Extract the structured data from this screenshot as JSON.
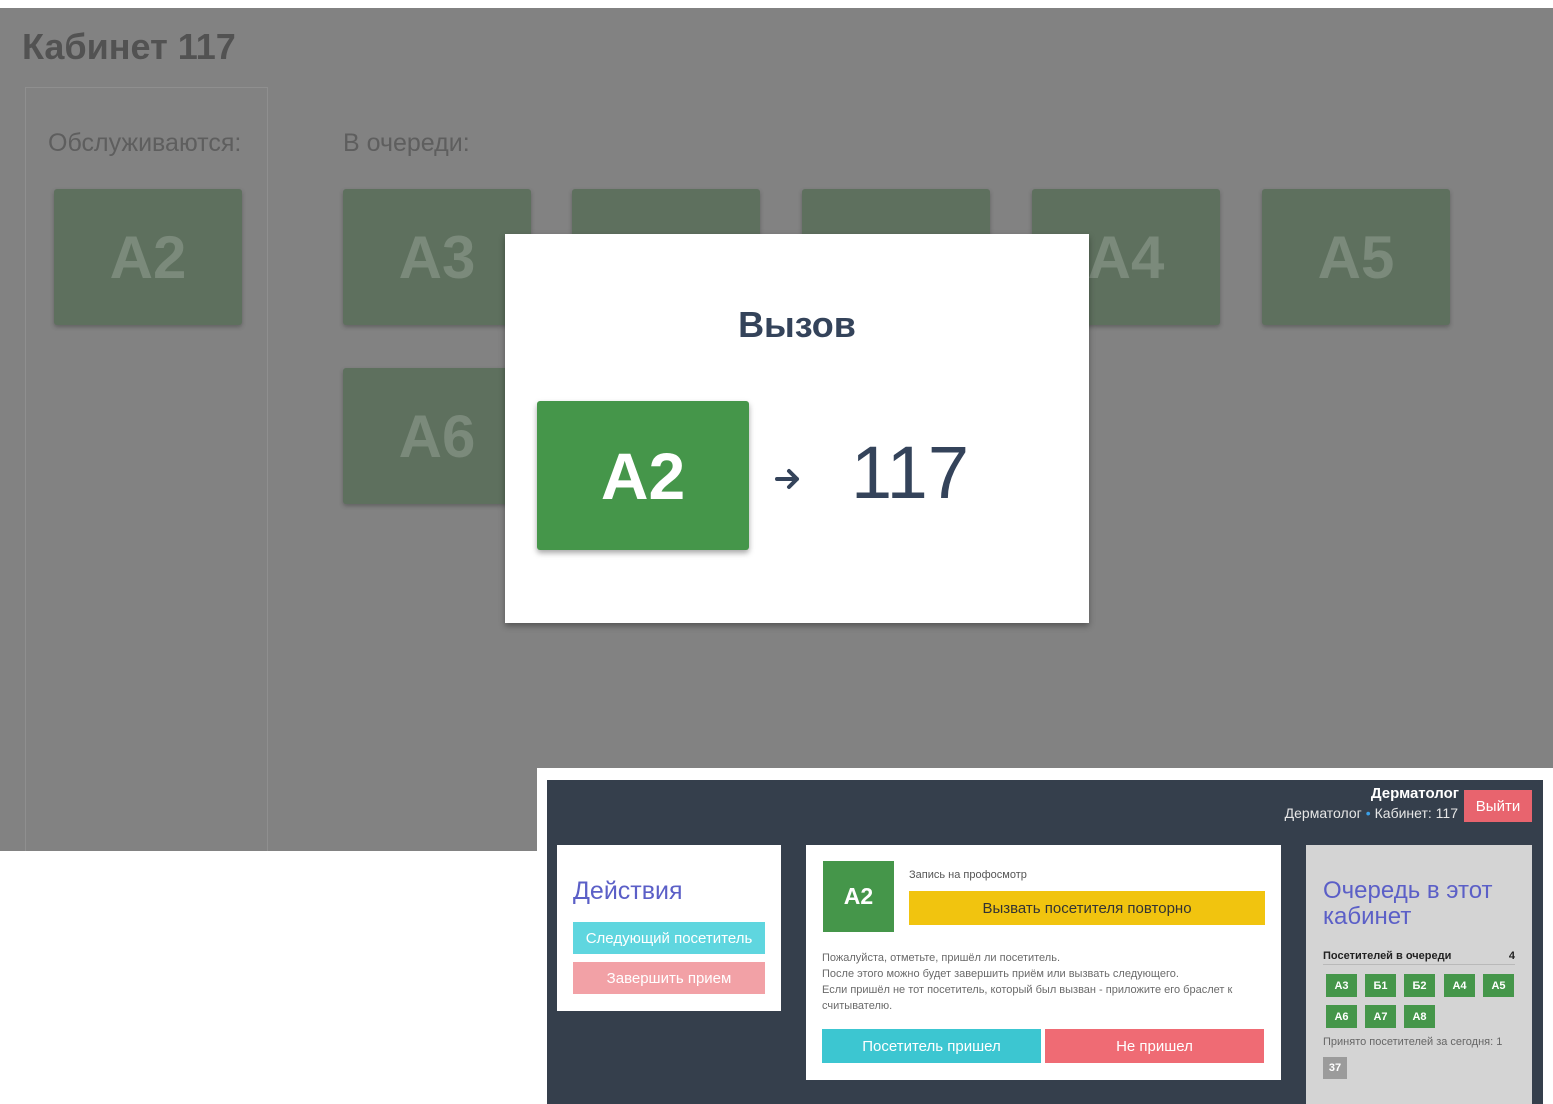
{
  "display": {
    "room_title": "Кабинет 117",
    "serving_label": "Обслуживаются:",
    "queue_label": "В очереди:",
    "serving_tickets": [
      "A2"
    ],
    "queue_tickets": [
      "A3",
      "",
      "",
      "A4",
      "A5",
      "A6"
    ],
    "modal": {
      "title": "Вызов",
      "ticket": "A2",
      "arrow_icon": "arrow-right-icon",
      "room": "117"
    }
  },
  "operator": {
    "header": {
      "user_name": "Дерматолог",
      "specialty": "Дерматолог",
      "room_label": "Кабинет: 117",
      "logout_label": "Выйти"
    },
    "actions": {
      "title": "Действия",
      "next_label": "Следующий посетитель",
      "finish_label": "Завершить прием"
    },
    "visitor": {
      "ticket": "A2",
      "purpose": "Запись на профосмотр",
      "recall_label": "Вызвать посетителя повторно",
      "notes": [
        "Пожалуйста, отметьте, пришёл ли посетитель.",
        "После этого можно будет завершить приём или вызвать следующего.",
        "Если пришёл не тот посетитель, который был вызван - приложите его браслет к считывателю."
      ],
      "came_label": "Посетитель пришел",
      "not_came_label": "Не пришел"
    },
    "queue": {
      "title": "Очередь в этот кабинет",
      "count_label": "Посетителей в очереди",
      "count_value": "4",
      "tickets": [
        "A3",
        "Б1",
        "Б2",
        "A4",
        "A5",
        "A6",
        "A7",
        "A8"
      ],
      "served_label": "Принято посетителей за сегодня: 1",
      "served_chip": "37"
    }
  },
  "colors": {
    "ticket_green": "#45964a",
    "dark_panel": "#353f4c",
    "accent_blue": "#5b5fc7",
    "recall_yellow": "#f1c40f",
    "came_cyan": "#3cc6d1",
    "not_came_red": "#ef6b74"
  }
}
